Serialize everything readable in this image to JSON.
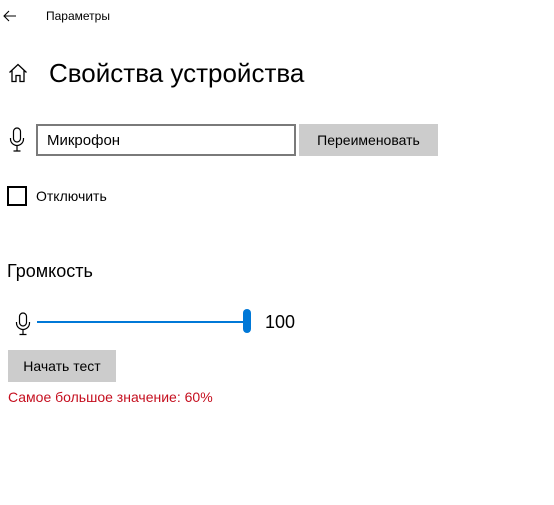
{
  "window": {
    "title": "Параметры",
    "back_icon": "arrow-left-icon"
  },
  "header": {
    "home_icon": "home-icon",
    "title": "Свойства устройства"
  },
  "device": {
    "icon": "microphone-icon",
    "name_value": "Микрофон",
    "rename_label": "Переименовать"
  },
  "disable": {
    "label": "Отключить",
    "checked": false
  },
  "volume": {
    "title": "Громкость",
    "icon": "microphone-icon",
    "level": 100,
    "max": 100,
    "value_text": "100",
    "test_label": "Начать тест",
    "peak_text": "Самое большое значение: 60%"
  },
  "colors": {
    "accent": "#0078d7",
    "button_bg": "#cccccc",
    "warning": "#c50f1f"
  }
}
